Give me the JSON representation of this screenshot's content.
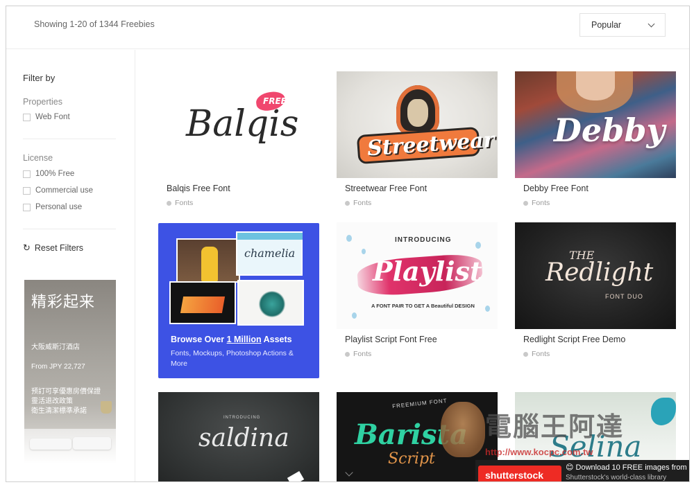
{
  "header": {
    "showing_text": "Showing 1-20 of 1344 Freebies",
    "sort": {
      "selected": "Popular"
    }
  },
  "sidebar": {
    "filter_heading": "Filter by",
    "groups": [
      {
        "title": "Properties",
        "options": [
          "Web Font"
        ]
      },
      {
        "title": "License",
        "options": [
          "100% Free",
          "Commercial use",
          "Personal use"
        ]
      }
    ],
    "reset_label": "Reset Filters",
    "ad": {
      "title": "精彩起来",
      "hotel": "大阪威斯汀酒店",
      "price": "From JPY 22,727",
      "lines": [
        "预訂可享優惠房價保證",
        "靈活退改政策",
        "衛生清潔標準承諾"
      ]
    }
  },
  "cards": [
    {
      "title": "Balqis Free Font",
      "category": "Fonts",
      "art_text": "Balqis",
      "badge": "FREE"
    },
    {
      "title": "Streetwear Free Font",
      "category": "Fonts",
      "art_text": "Streetwear"
    },
    {
      "title": "Debby Free Font",
      "category": "Fonts",
      "art_text": "Debby"
    },
    {
      "title": "Playlist Script Font Free",
      "category": "Fonts",
      "art_text": "Playlist",
      "art_top": "INTRODUCING",
      "art_bottom": "A FONT PAIR TO GET A Beautiful DESIGN"
    },
    {
      "title": "Redlight Script Free Demo",
      "category": "Fonts",
      "art_text": "Redlight",
      "art_top": "THE",
      "art_bottom": "FONT DUO"
    },
    {
      "art_text": "saldina",
      "art_top": "INTRODUCING"
    },
    {
      "art_text": "Barista",
      "art_top": "FREEMIUM FONT",
      "art_bottom": "Script"
    },
    {
      "art_text": "Selina"
    }
  ],
  "promo": {
    "line1_prefix": "Browse Over ",
    "line1_link": "1 Million",
    "line1_suffix": " Assets",
    "line2": "Fonts, Mockups, Photoshop Actions & More",
    "mock_text": "chamelia"
  },
  "watermark": {
    "text": "電腦王阿達",
    "url": "http://www.kocpc.com.tw"
  },
  "shutterstock": {
    "logo": "shutterstock",
    "text": "Download 10 FREE images from",
    "sub": "Shutterstock's world-class library"
  },
  "colors": {
    "promo_bg": "#3d52e4",
    "badge": "#f0476e",
    "playlist_brush": "#e0336b",
    "ss_red": "#ee2b24"
  }
}
